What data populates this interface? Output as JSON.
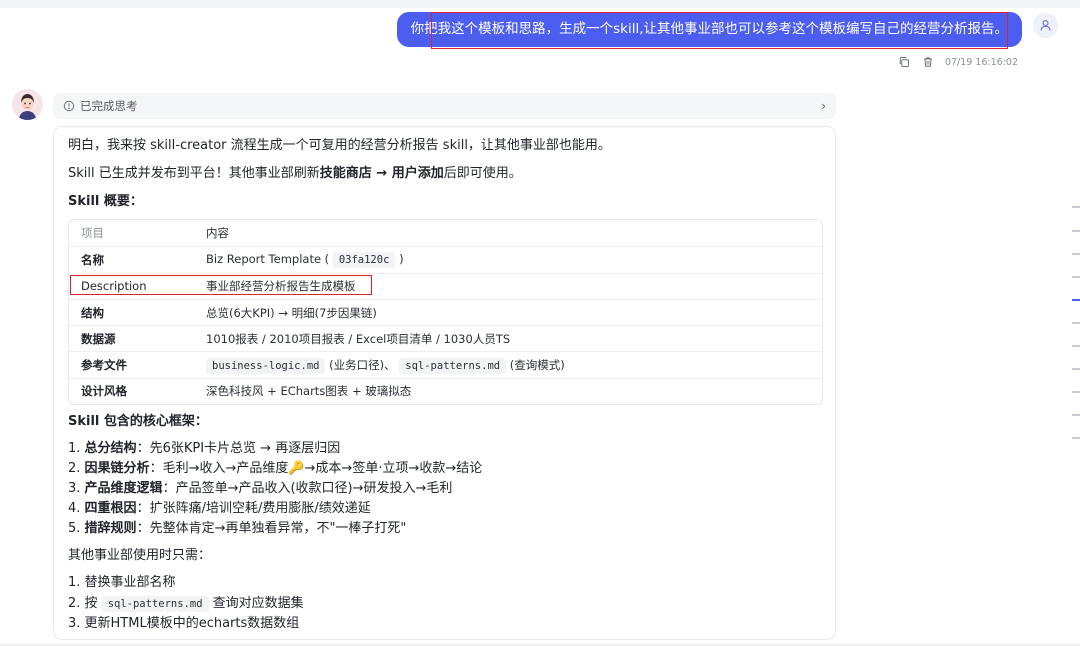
{
  "user": {
    "message": "你把我这个模板和思路，生成一个skill,让其他事业部也可以参考这个模板编写自己的经营分析报告。",
    "timestamp": "07/19 16:16:02"
  },
  "think": {
    "label": "已完成思考"
  },
  "answer": {
    "p1": "明白，我来按 skill-creator 流程生成一个可复用的经营分析报告 skill，让其他事业部也能用。",
    "p2_pre": "Skill 已生成并发布到平台！其他事业部刷新",
    "p2_bold1": "技能商店 → 用户添加",
    "p2_post": "后即可使用。",
    "overview_title": "Skill 概要：",
    "table": {
      "head": [
        "项目",
        "内容"
      ],
      "rows": [
        {
          "k": "名称",
          "pre": "Biz Report Template (",
          "code": "03fa120c",
          "post": ")"
        },
        {
          "k": "Description",
          "v": "事业部经营分析报告生成模板"
        },
        {
          "k": "结构",
          "v": "总览(6大KPI) → 明细(7步因果链)"
        },
        {
          "k": "数据源",
          "v": "1010报表 / 2010项目报表 / Excel项目清单 / 1030人员TS"
        },
        {
          "k": "参考文件",
          "code1": "business-logic.md",
          "mid": "(业务口径)、",
          "code2": "sql-patterns.md",
          "post": "(查询模式)"
        },
        {
          "k": "设计风格",
          "v": "深色科技风 + ECharts图表 + 玻璃拟态"
        }
      ]
    },
    "framework_title": "Skill 包含的核心框架：",
    "framework": [
      {
        "n": "1.",
        "b": "总分结构",
        "t": "：先6张KPI卡片总览 → 再逐层归因"
      },
      {
        "n": "2.",
        "b": "因果链分析",
        "t": "：毛利→收入→产品维度🔑→成本→签单·立项→收款→结论"
      },
      {
        "n": "3.",
        "b": "产品维度逻辑",
        "t": "：产品签单→产品收入(收款口径)→研发投入→毛利"
      },
      {
        "n": "4.",
        "b": "四重根因",
        "t": "：扩张阵痛/培训空耗/费用膨胀/绩效递延"
      },
      {
        "n": "5.",
        "b": "措辞规则",
        "t": "：先整体肯定→再单独看异常，不\"一棒子打死\""
      }
    ],
    "other_title": "其他事业部使用时只需：",
    "steps": {
      "s1": "1. 替换事业部名称",
      "s2_pre": "2. 按",
      "s2_code": "sql-patterns.md",
      "s2_post": "查询对应数据集",
      "s3": "3. 更新HTML模板中的echarts数据数组"
    }
  },
  "icons": {
    "copy": "copy-icon",
    "delete": "trash-icon",
    "think": "lightbulb-icon",
    "chevron": "chevron-right-icon",
    "user": "user-icon"
  },
  "colors": {
    "accent": "#4b5ef0",
    "highlight": "#e0202a"
  }
}
